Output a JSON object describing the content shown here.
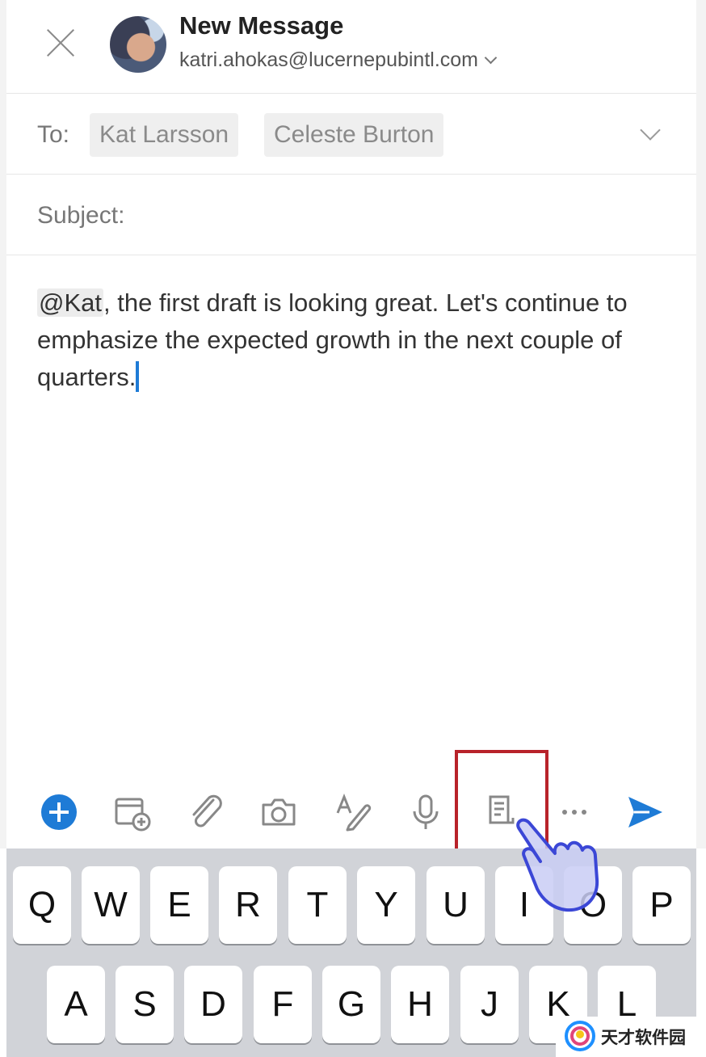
{
  "header": {
    "title": "New Message",
    "from_address": "katri.ahokas@lucernepubintl.com"
  },
  "to": {
    "label": "To:",
    "recipients": [
      "Kat Larsson",
      "Celeste Burton"
    ]
  },
  "subject": {
    "label": "Subject:"
  },
  "body": {
    "mention": "@Kat",
    "text": ", the first draft is looking great. Let's continue to emphasize the expected growth in the next couple of quarters."
  },
  "toolbar": {
    "icons": [
      "add-icon",
      "calendar-add-icon",
      "attach-icon",
      "camera-icon",
      "format-text-icon",
      "microphone-icon",
      "template-icon",
      "more-icon",
      "send-icon"
    ],
    "accent": "#1e7bd6",
    "highlight_color": "#b8232a"
  },
  "keyboard": {
    "row1": [
      "Q",
      "W",
      "E",
      "R",
      "T",
      "Y",
      "U",
      "I",
      "O",
      "P"
    ],
    "row2": [
      "A",
      "S",
      "D",
      "F",
      "G",
      "H",
      "J",
      "K",
      "L"
    ]
  },
  "watermark": {
    "text": "天才软件园"
  }
}
